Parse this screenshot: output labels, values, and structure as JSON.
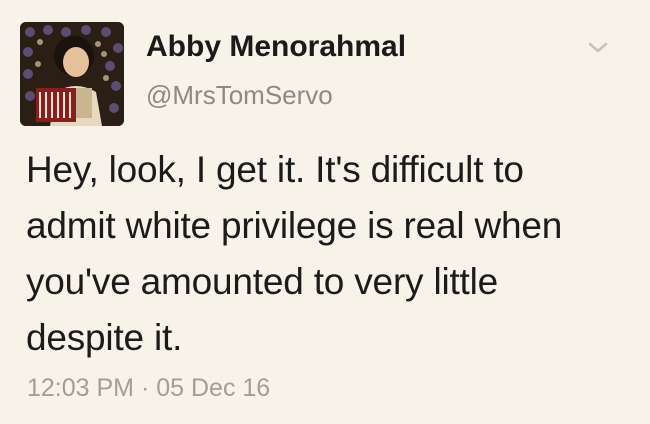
{
  "user": {
    "display_name": "Abby Menorahmal",
    "handle": "@MrsTomServo",
    "avatar_icon": "user-avatar-accordion-photo"
  },
  "tweet": {
    "lines": [
      "Hey, look, I get it. It's difficult to",
      "admit white privilege is real when",
      "you've amounted to very little",
      "despite it."
    ],
    "time": "12:03 PM",
    "separator": "·",
    "date": "05 Dec 16"
  },
  "icons": {
    "menu": "chevron-down-icon"
  },
  "colors": {
    "background": "#f8f3e8",
    "text": "#1b1b1b",
    "muted": "#8e8a82"
  }
}
